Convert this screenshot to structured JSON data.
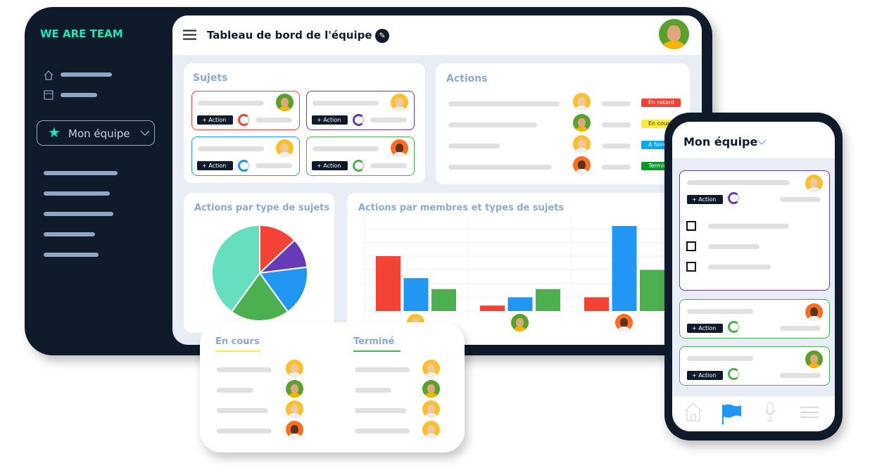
{
  "brand": "WE ARE TEAM",
  "sidebar": {
    "team_button": "Mon équipe",
    "icons": [
      "home-icon",
      "store-icon",
      "star-icon",
      "chevron-down-icon"
    ]
  },
  "header": {
    "title": "Tableau de bord de l'équipe",
    "icons": [
      "menu-icon",
      "edit-icon"
    ]
  },
  "sujets": {
    "title": "Sujets",
    "cards": [
      {
        "color": "#f44336",
        "action": "+ Action",
        "avatar": "man-green"
      },
      {
        "color": "#673ab7",
        "action": "+ Action",
        "avatar": "woman-yellow"
      },
      {
        "color": "#2196f3",
        "action": "+ Action",
        "avatar": "woman-yellow"
      },
      {
        "color": "#4caf50",
        "action": "+ Action",
        "avatar": "man-orange"
      }
    ]
  },
  "actions": {
    "title": "Actions",
    "rows": [
      {
        "status": "En retard",
        "color": "#f44336",
        "avatar": "woman-yellow"
      },
      {
        "status": "En cours",
        "color": "#ffeb3b",
        "avatar": "man-green"
      },
      {
        "status": "A faire",
        "color": "#03a9f4",
        "avatar": "woman-yellow"
      },
      {
        "status": "Terminé",
        "color": "#0a9a2a",
        "avatar": "man-orange"
      }
    ]
  },
  "chart_data": [
    {
      "type": "pie",
      "title": "Actions par type de sujets",
      "values": [
        13,
        10,
        17,
        20,
        40
      ],
      "colors": [
        "#f44336",
        "#673ab7",
        "#2196f3",
        "#4caf50",
        "#66dec0"
      ]
    },
    {
      "type": "bar",
      "title": "Actions par membres et types de sujets",
      "categories": [
        "woman-yellow",
        "man-green",
        "man-orange"
      ],
      "series": [
        {
          "color": "#f44336",
          "values": [
            4,
            0.4,
            1
          ]
        },
        {
          "color": "#2196f3",
          "values": [
            2.4,
            1,
            6.2
          ]
        },
        {
          "color": "#4caf50",
          "values": [
            1.6,
            1.6,
            3
          ]
        }
      ],
      "ylim": [
        0,
        7
      ],
      "grid": true
    }
  ],
  "board": {
    "columns": [
      {
        "title": "En cours",
        "color": "#ffeb3b",
        "avatars": [
          "woman-yellow",
          "man-green",
          "woman-yellow",
          "man-orange"
        ]
      },
      {
        "title": "Terminé",
        "color": "#4caf50",
        "avatars": [
          "woman-yellow",
          "man-green",
          "woman-yellow",
          "woman-yellow"
        ]
      }
    ]
  },
  "phone": {
    "title": "Mon équipe",
    "action": "+ Action",
    "nav": [
      "home-icon",
      "flag-icon",
      "microphone-icon",
      "menu-icon"
    ],
    "active_nav": "flag-icon"
  }
}
